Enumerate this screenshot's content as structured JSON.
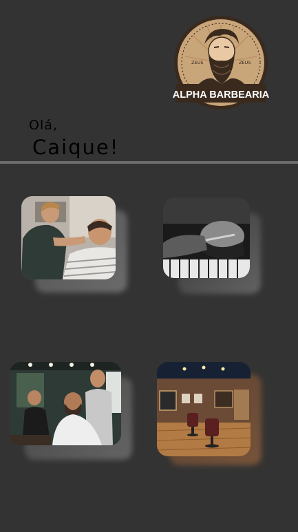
{
  "brand": {
    "name": "ALPHA BARBEARIA",
    "seal_left": "ZEUS",
    "seal_right": "ZEUS"
  },
  "greeting": {
    "hello": "Olá,",
    "name": "Caique!"
  },
  "services": [
    {
      "icon": "haircut-photo"
    },
    {
      "icon": "beard-trim-photo"
    },
    {
      "icon": "barbers-at-work-photo"
    },
    {
      "icon": "barbershop-interior-photo"
    }
  ],
  "colors": {
    "background": "#333333",
    "divider": "#6b6b6b",
    "logo_tan": "#c9a57a",
    "logo_dark": "#3a2a1e"
  }
}
